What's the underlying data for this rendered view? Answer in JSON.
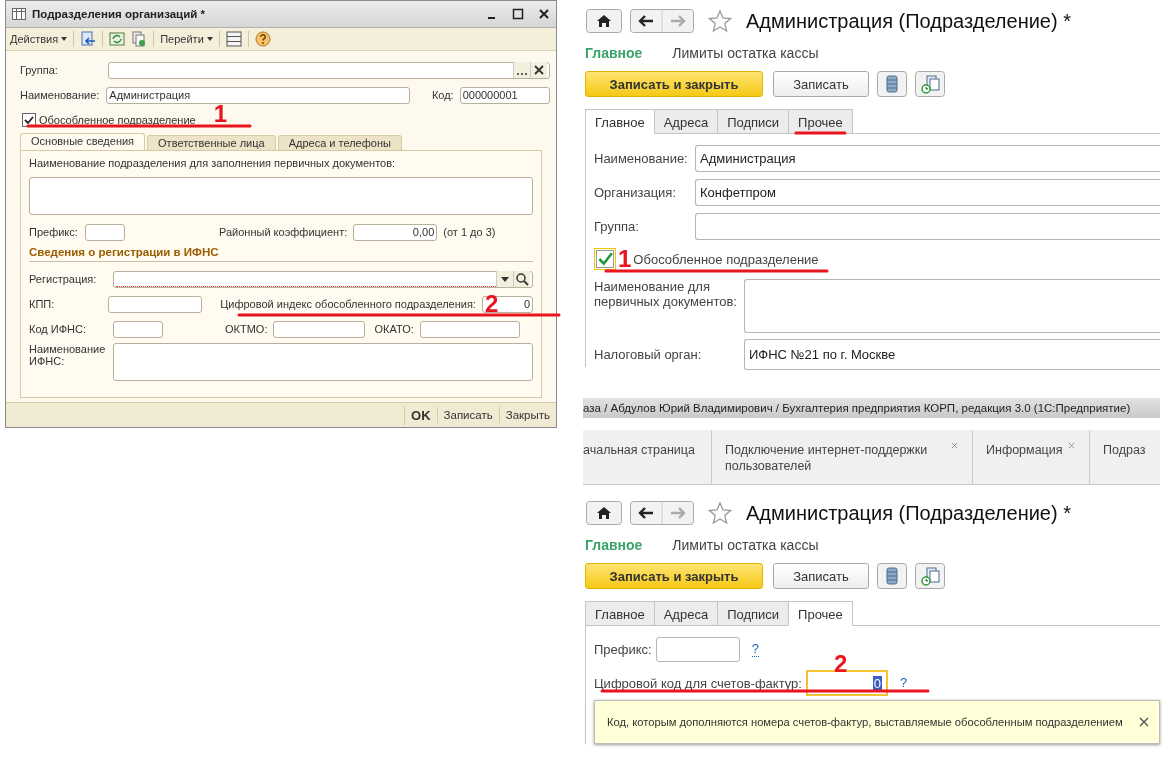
{
  "legacy_window": {
    "title": "Подразделения организаций *",
    "actions_menu": "Действия",
    "goto_menu": "Перейти",
    "group_label": "Группа:",
    "name": {
      "label": "Наименование:",
      "value": "Администрация"
    },
    "code": {
      "label": "Код:",
      "value": "000000001"
    },
    "separate": {
      "label": "Обособленное подразделение",
      "checked": true,
      "annotation": "1"
    },
    "tabs": [
      {
        "label": "Основные сведения",
        "selected": true
      },
      {
        "label": "Ответственные лица",
        "selected": false
      },
      {
        "label": "Адреса и телефоны",
        "selected": false
      }
    ],
    "primary_docs_label": "Наименование подразделения для заполнения первичных документов:",
    "prefix_label": "Префикс:",
    "coefficient": {
      "label": "Районный коэффициент:",
      "value": "0,00",
      "hint": "(от 1 до 3)"
    },
    "section_title": "Сведения о регистрации в ИФНС",
    "registration_label": "Регистрация:",
    "kpp_label": "КПП:",
    "index": {
      "label": "Цифровой индекс обособленного подразделения:",
      "value": "0",
      "annotation": "2"
    },
    "ifns_code_label": "Код ИФНС:",
    "oktmo_label": "ОКТМО:",
    "okato_label": "ОКАТО:",
    "ifns_name_label": "Наименование ИФНС:",
    "buttons": [
      {
        "label": "OK",
        "default": true
      },
      {
        "label": "Записать",
        "default": false
      },
      {
        "label": "Закрыть",
        "default": false
      }
    ]
  },
  "form_top": {
    "title": "Администрация (Подразделение) *",
    "sections": [
      {
        "label": "Главное",
        "selected": true
      },
      {
        "label": "Лимиты остатка кассы",
        "selected": false
      }
    ],
    "save_close": "Записать и закрыть",
    "save": "Записать",
    "tabs": [
      {
        "label": "Главное",
        "selected": true,
        "annotated": false
      },
      {
        "label": "Адреса",
        "selected": false,
        "annotated": false
      },
      {
        "label": "Подписи",
        "selected": false,
        "annotated": false
      },
      {
        "label": "Прочее",
        "selected": false,
        "annotated": true
      }
    ],
    "name": {
      "label": "Наименование:",
      "value": "Администрация"
    },
    "organization": {
      "label": "Организация:",
      "value": "Конфетпром"
    },
    "group_label": "Группа:",
    "separate": {
      "label": "Обособленное подразделение",
      "checked": true,
      "annotation": "1"
    },
    "primary_docs_label": "Наименование для первичных документов:",
    "tax_office": {
      "label": "Налоговый орган:",
      "value": "ИФНС №21 по г. Москве"
    }
  },
  "app_bar": {
    "title": "аза / Абдулов Юрий Владимирович / Бухгалтерия предприятия КОРП, редакция 3.0  (1С:Предприятие)",
    "open_tabs": [
      {
        "label": "ачальная страница",
        "closable": false
      },
      {
        "label": "Подключение интернет-поддержки пользователей",
        "closable": true
      },
      {
        "label": "Информация",
        "closable": true
      },
      {
        "label": "Подраз",
        "closable": false
      }
    ]
  },
  "form_bottom": {
    "title": "Администрация (Подразделение) *",
    "sections": [
      {
        "label": "Главное",
        "selected": true
      },
      {
        "label": "Лимиты остатка кассы",
        "selected": false
      }
    ],
    "save_close": "Записать и закрыть",
    "save": "Записать",
    "tabs": [
      {
        "label": "Главное",
        "selected": false
      },
      {
        "label": "Адреса",
        "selected": false
      },
      {
        "label": "Подписи",
        "selected": false
      },
      {
        "label": "Прочее",
        "selected": true
      }
    ],
    "prefix": {
      "label": "Префикс:",
      "help": "?"
    },
    "invoice_code": {
      "label": "Цифровой код для счетов-фактур:",
      "value": "0",
      "help": "?",
      "annotation": "2"
    },
    "tooltip": "Код, которым дополняются номера счетов-фактур, выставляемые обособленным подразделением"
  }
}
